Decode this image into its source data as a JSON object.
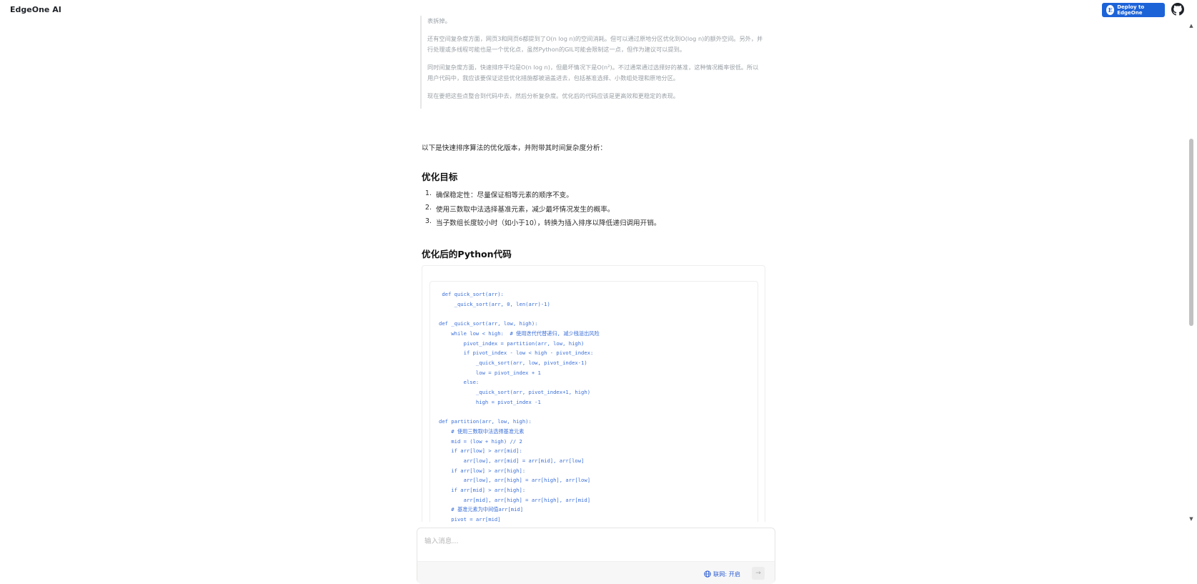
{
  "header": {
    "app_title": "EdgeOne AI",
    "deploy_label": "Deploy to EdgeOne",
    "deploy_logo_text": "E",
    "github_icon": "github-icon"
  },
  "thinking": {
    "lines": [
      "表拆掉。",
      "还有空间复杂度方面，网页3和网页6都提到了O(n log n)的空间消耗。但可以通过原地分区优化到O(log n)的额外空间。另外，并行处理或多线程可能也是一个优化点，虽然Python的GIL可能会限制这一点，但作为建议可以提到。",
      "同时间复杂度方面，快速排序平均是O(n log n)，但最坏情况下是O(n²)。不过通常通过选择好的基准，这种情况概率很低。所以用户代码中，我应该要保证这些优化措施都被涵盖进去，包括基准选择、小数组处理和原地分区。",
      "现在要把这些点整合到代码中去，然后分析复杂度。优化后的代码应该是更高效和更稳定的表现。"
    ]
  },
  "answer": {
    "intro": "以下是快速排序算法的优化版本，并附带其时间复杂度分析：",
    "goals_heading": "优化目标",
    "goals": [
      {
        "num": "1.",
        "text": "确保稳定性：尽量保证相等元素的顺序不变。"
      },
      {
        "num": "2.",
        "text": "使用三数取中法选择基准元素，减少最坏情况发生的概率。"
      },
      {
        "num": "3.",
        "text": "当子数组长度较小时（如小于10），转换为插入排序以降低递归调用开销。"
      }
    ],
    "code_heading": "优化后的Python代码",
    "code": " def quick_sort(arr):\n     _quick_sort(arr, 0, len(arr)-1)\n\ndef _quick_sort(arr, low, high):\n    while low < high:  # 使用迭代代替递归, 减少栈溢出风险\n        pivot_index = partition(arr, low, high)\n        if pivot_index - low < high - pivot_index:\n            _quick_sort(arr, low, pivot_index-1)\n            low = pivot_index + 1\n        else:\n            _quick_sort(arr, pivot_index+1, high)\n            high = pivot_index -1\n\ndef partition(arr, low, high):\n    # 使用三数取中法选择基准元素\n    mid = (low + high) // 2\n    if arr[low] > arr[mid]:\n        arr[low], arr[mid] = arr[mid], arr[low]\n    if arr[low] > arr[high]:\n        arr[low], arr[high] = arr[high], arr[low]\n    if arr[mid] > arr[high]:\n        arr[mid], arr[high] = arr[high], arr[mid]\n    # 基准元素为中间值arr[mid]\n    pivot = arr[mid]"
  },
  "input": {
    "placeholder": "输入消息...",
    "value": "",
    "web_label": "联网: 开启",
    "send_symbol": "→"
  },
  "colors": {
    "deploy_bg": "#1d63d8",
    "code_text": "#3a6fd8",
    "thinking_text": "#9aa0a6",
    "web_toggle": "#2f5fd0"
  }
}
